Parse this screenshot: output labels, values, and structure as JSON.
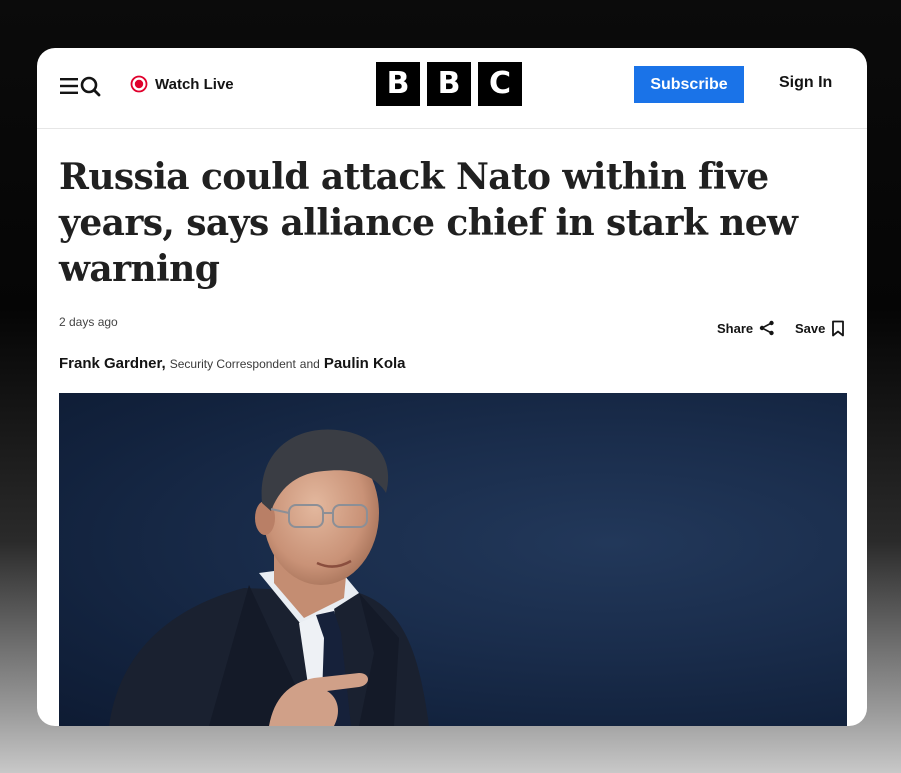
{
  "header": {
    "watch_live_label": "Watch Live",
    "logo_letters": [
      "B",
      "B",
      "C"
    ],
    "subscribe_label": "Subscribe",
    "signin_label": "Sign In"
  },
  "article": {
    "headline": "Russia could attack Nato within five years, says alliance chief in stark new warning",
    "timestamp": "2 days ago",
    "share_label": "Share",
    "save_label": "Save",
    "byline": {
      "author1": "Frank Gardner,",
      "role": "Security Correspondent",
      "conjunction": "and",
      "author2": "Paulin Kola"
    }
  },
  "colors": {
    "accent_blue": "#1a73e8",
    "live_red": "#e0002c",
    "logo_black": "#000000"
  },
  "icons": [
    "menu-icon",
    "search-icon",
    "live-dot-icon",
    "share-icon",
    "bookmark-icon"
  ]
}
